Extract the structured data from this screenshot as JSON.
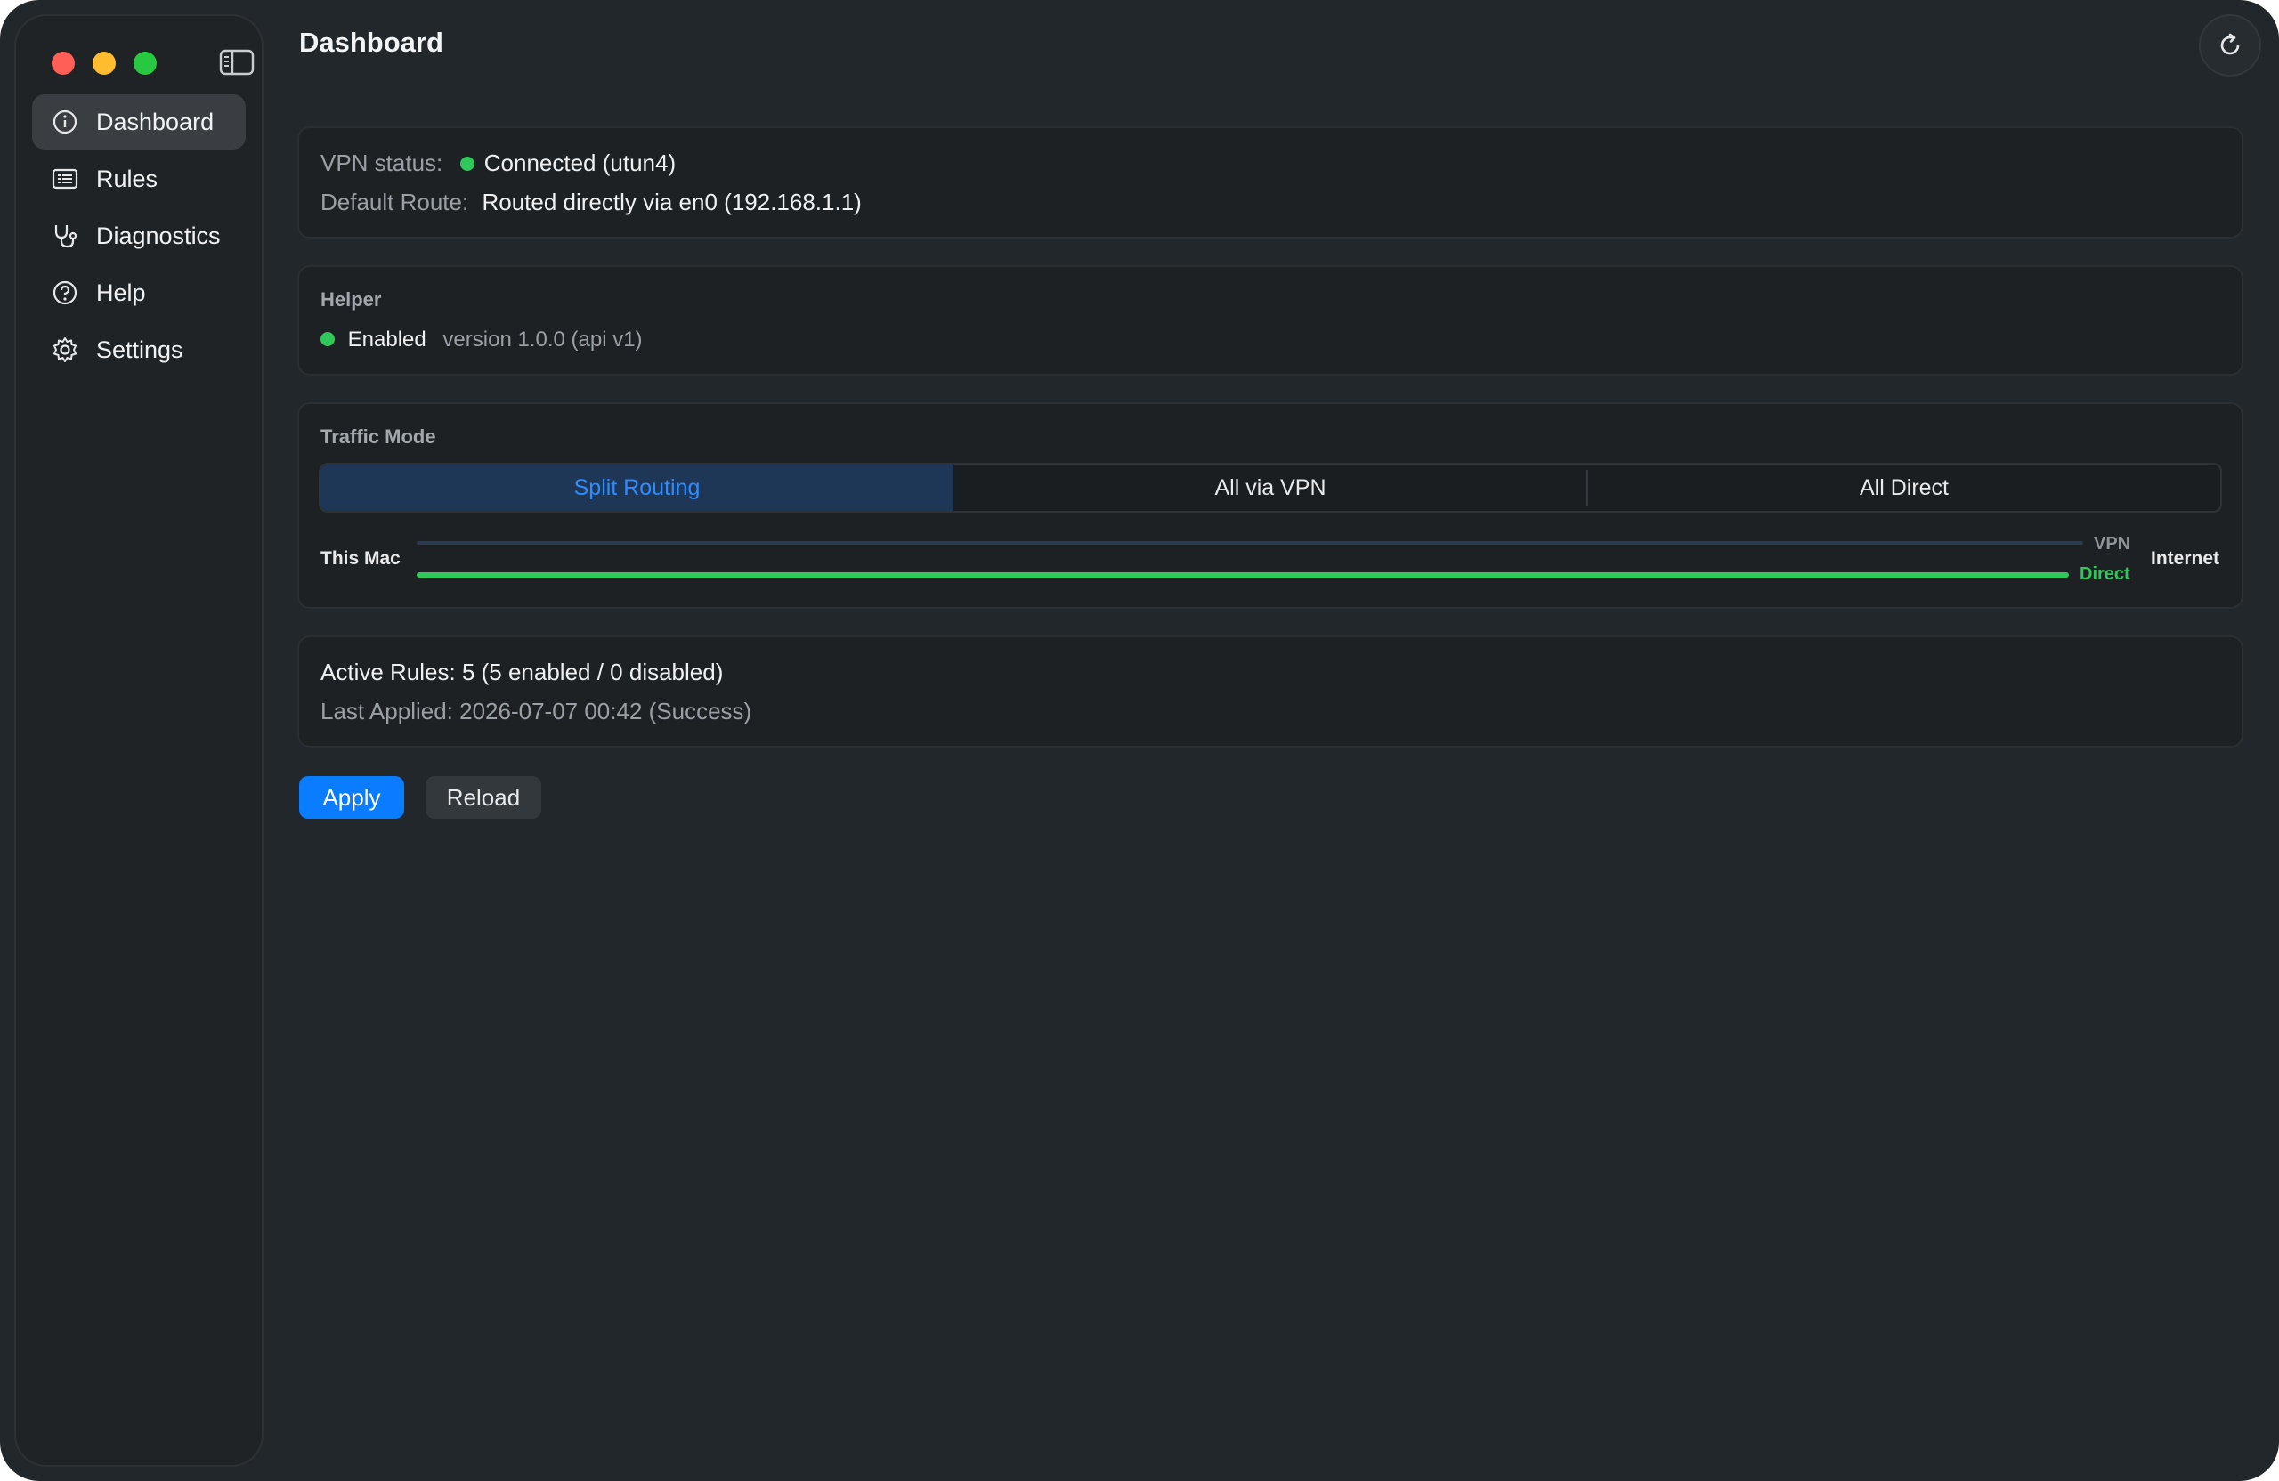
{
  "window": {
    "title": "Dashboard"
  },
  "sidebar": {
    "items": [
      {
        "label": "Dashboard",
        "icon": "info-circle-icon",
        "active": true
      },
      {
        "label": "Rules",
        "icon": "list-icon",
        "active": false
      },
      {
        "label": "Diagnostics",
        "icon": "stethoscope-icon",
        "active": false
      },
      {
        "label": "Help",
        "icon": "question-circle-icon",
        "active": false
      },
      {
        "label": "Settings",
        "icon": "gear-icon",
        "active": false
      }
    ]
  },
  "vpn_card": {
    "status_label": "VPN status:",
    "status_value": "Connected (utun4)",
    "route_label": "Default Route:",
    "route_value": "Routed directly via en0 (192.168.1.1)"
  },
  "helper_card": {
    "title": "Helper",
    "status": "Enabled",
    "version": "version 1.0.0 (api v1)"
  },
  "traffic_card": {
    "title": "Traffic Mode",
    "modes": [
      "Split Routing",
      "All via VPN",
      "All Direct"
    ],
    "selected_mode": "Split Routing",
    "source_label": "This Mac",
    "dest_label": "Internet",
    "vpn_label": "VPN",
    "direct_label": "Direct"
  },
  "rules_card": {
    "active_rules": "Active Rules: 5 (5 enabled / 0 disabled)",
    "last_applied": "Last Applied: 2026-07-07 00:42 (Success)"
  },
  "actions": {
    "apply_label": "Apply",
    "reload_label": "Reload"
  },
  "colors": {
    "accent": "#0a7cff",
    "status_green": "#30c85a",
    "selected_segment_text": "#2f8cff"
  }
}
